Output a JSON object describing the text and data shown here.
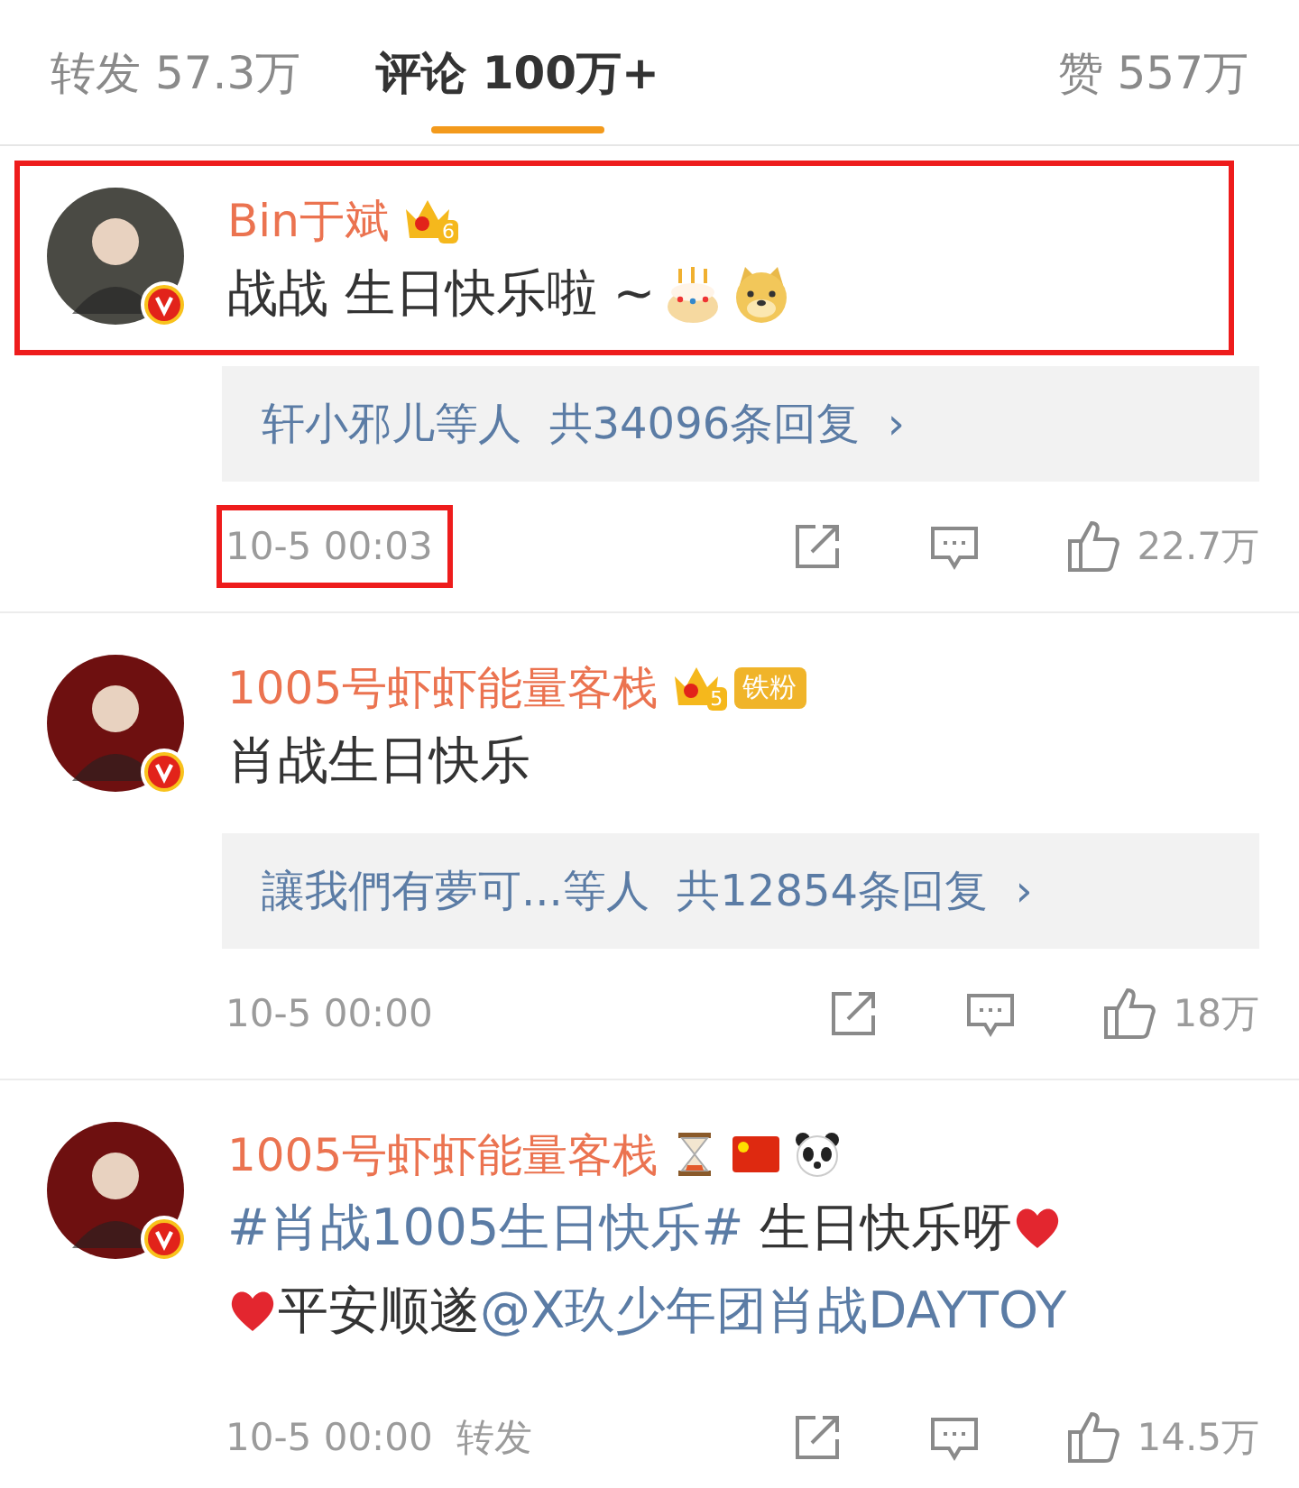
{
  "tabs": [
    {
      "label": "转发",
      "count": "57.3万",
      "selected": false
    },
    {
      "label": "评论",
      "count": "100万+",
      "selected": true
    },
    {
      "label": "赞",
      "count": "557万",
      "selected": false
    }
  ],
  "comments": [
    {
      "color": "#4a4a44",
      "highlighted": true,
      "name": "Bin于斌",
      "badges": [
        {
          "kind": "crown",
          "level": "6"
        }
      ],
      "lines": [
        [
          {
            "kind": "text",
            "text": "战战 生日快乐啦 ~"
          },
          {
            "kind": "cake"
          },
          {
            "kind": "doge"
          }
        ]
      ],
      "replies": {
        "names": "轩小邪儿等人",
        "total": "共34096条回复",
        "arrow": "›"
      },
      "time": "10-5 00:03",
      "time_highlighted": true,
      "likes": "22.7万"
    },
    {
      "color": "#6e1010",
      "highlighted": false,
      "name": "1005号虾虾能量客栈",
      "badges": [
        {
          "kind": "crown",
          "level": "5"
        },
        {
          "kind": "fan",
          "label": "铁粉"
        }
      ],
      "lines": [
        [
          {
            "kind": "text",
            "text": "肖战生日快乐"
          }
        ]
      ],
      "replies": {
        "names": "讓我們有夢可...等人",
        "total": "共12854条回复",
        "arrow": "›"
      },
      "time": "10-5 00:00",
      "time_highlighted": false,
      "likes": "18万"
    },
    {
      "color": "#6e1010",
      "highlighted": false,
      "name": "1005号虾虾能量客栈",
      "badges": [
        {
          "kind": "hourglass"
        },
        {
          "kind": "flag"
        },
        {
          "kind": "panda"
        }
      ],
      "lines": [
        [
          {
            "kind": "link",
            "text": "#肖战1005生日快乐#"
          },
          {
            "kind": "text",
            "text": " 生日快乐呀"
          },
          {
            "kind": "heart"
          }
        ],
        [
          {
            "kind": "heart"
          },
          {
            "kind": "text",
            "text": "平安顺遂"
          },
          {
            "kind": "link",
            "text": "@X玖少年团肖战DAYTOY"
          }
        ]
      ],
      "time": "10-5 00:00",
      "repost": "转发",
      "time_highlighted": false,
      "likes": "14.5万"
    }
  ]
}
